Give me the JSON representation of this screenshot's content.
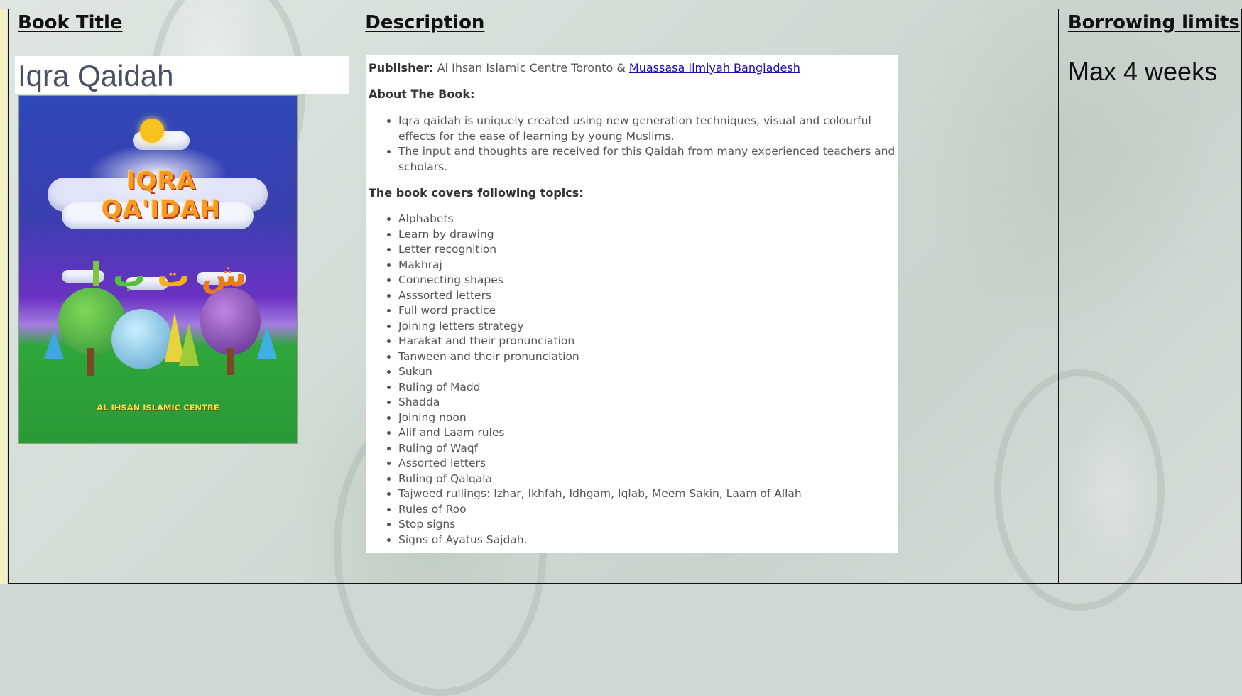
{
  "headers": {
    "book_title": "Book Title",
    "description": "Description",
    "borrowing_limits": "Borrowing limits"
  },
  "book": {
    "title": "Iqra Qaidah",
    "cover": {
      "title_text": "IQRA QA'IDAH",
      "arabic_letters": [
        "ش",
        "ت",
        "ب",
        "ا"
      ],
      "publisher_text": "AL IHSAN ISLAMIC CENTRE"
    },
    "publisher_label": "Publisher:",
    "publisher_text": "Al Ihsan Islamic Centre Toronto & ",
    "publisher_link": "Muassasa Ilmiyah Bangladesh",
    "about_heading": "About The Book:",
    "about_items": [
      "Iqra qaidah is uniquely created using new generation techniques, visual and colourful effects for the ease of learning by young Muslims.",
      "The input and thoughts are received for this Qaidah from many experienced teachers and scholars."
    ],
    "topics_heading": "The book covers following topics:",
    "topics": [
      "Alphabets",
      "Learn by drawing",
      "Letter recognition",
      "Makhraj",
      "Connecting shapes",
      "Asssorted letters",
      "Full word practice",
      "Joining letters strategy",
      "Harakat and their pronunciation",
      "Tanween and their pronunciation",
      "Sukun",
      "Ruling of Madd",
      "Shadda",
      "Joining noon",
      "Alif and Laam rules",
      "Ruling of Waqf",
      "Assorted letters",
      "Ruling of Qalqala",
      "Tajweed rullings: Izhar, Ikhfah, Idhgam, Iqlab, Meem Sakin, Laam of Allah",
      "Rules of Roo",
      "Stop signs",
      "Signs of Ayatus Sajdah."
    ],
    "borrowing_limit": "Max 4 weeks"
  }
}
